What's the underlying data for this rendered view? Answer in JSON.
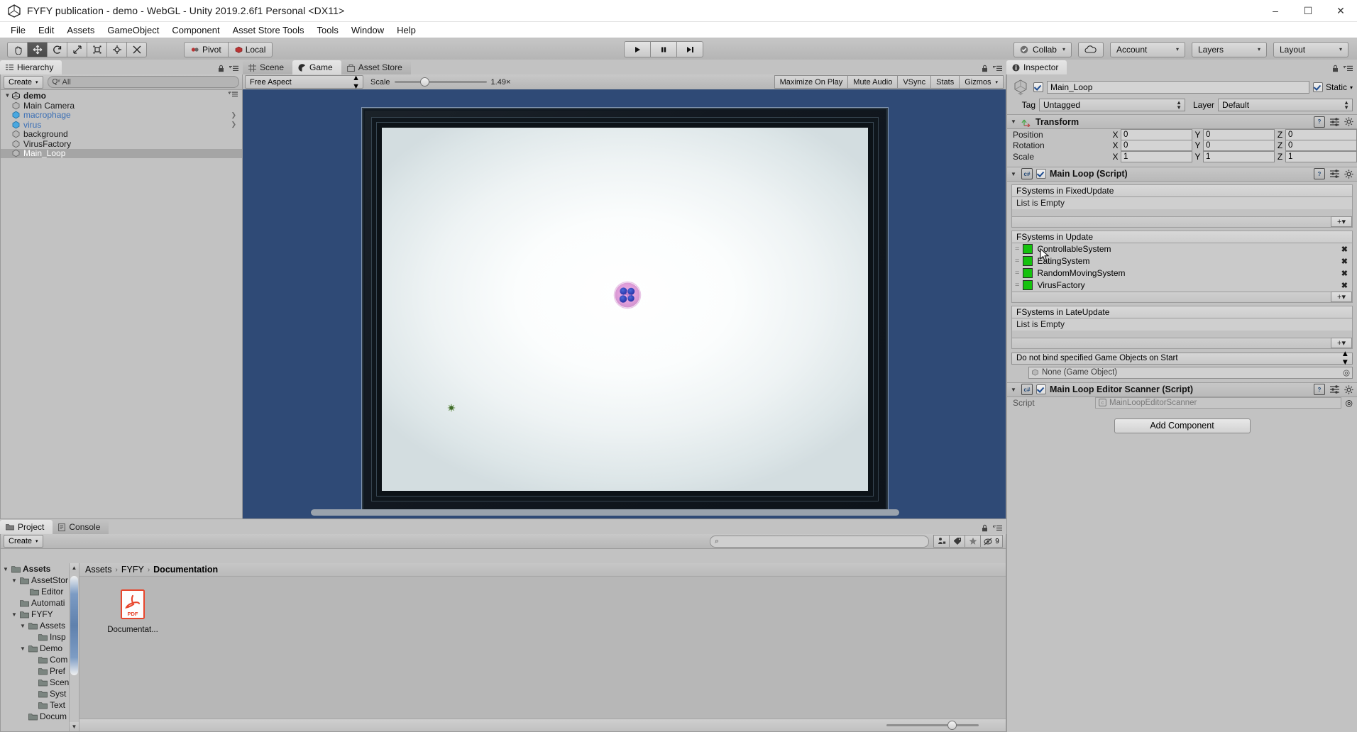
{
  "window": {
    "title": "FYFY publication - demo - WebGL - Unity 2019.2.6f1 Personal <DX11>",
    "minimize": "–",
    "maximize": "☐",
    "close": "✕"
  },
  "menubar": {
    "items": [
      "File",
      "Edit",
      "Assets",
      "GameObject",
      "Component",
      "Asset Store Tools",
      "Tools",
      "Window",
      "Help"
    ]
  },
  "toolbar": {
    "tools": [
      "hand-tool",
      "move-tool",
      "rotate-tool",
      "scale-tool",
      "rect-tool",
      "transform-tool",
      "custom-tool"
    ],
    "active_tool_index": 1,
    "pivot_label": "Pivot",
    "local_label": "Local",
    "play_label": "▶",
    "pause_label": "❙❙",
    "step_label": "▶|",
    "collab_label": "Collab",
    "cloud_label": "cloud-icon",
    "account_label": "Account",
    "layers_label": "Layers",
    "layout_label": "Layout",
    "caret": "▾"
  },
  "hierarchy": {
    "tab_label": "Hierarchy",
    "create_label": "Create",
    "create_caret": "▾",
    "search_placeholder": "All",
    "search_icon": "Qᵛ",
    "root": {
      "label": "demo",
      "expanded": true
    },
    "items": [
      {
        "label": "Main Camera",
        "type": "gameobject",
        "has_children": false
      },
      {
        "label": "macrophage",
        "type": "prefab",
        "has_children": true
      },
      {
        "label": "virus",
        "type": "prefab",
        "has_children": true
      },
      {
        "label": "background",
        "type": "gameobject",
        "has_children": false
      },
      {
        "label": "VirusFactory",
        "type": "gameobject",
        "has_children": false
      },
      {
        "label": "Main_Loop",
        "type": "gameobject",
        "has_children": false,
        "selected": true
      }
    ]
  },
  "gameview": {
    "tabs": [
      {
        "label": "Scene",
        "icon": "grid-icon",
        "selected": false
      },
      {
        "label": "Game",
        "icon": "gamepad-icon",
        "selected": true
      },
      {
        "label": "Asset Store",
        "icon": "store-icon",
        "selected": false
      }
    ],
    "aspect": "Free Aspect",
    "scale_label": "Scale",
    "scale_value": "1.49×",
    "buttons": [
      "Maximize On Play",
      "Mute Audio",
      "VSync",
      "Stats",
      "Gizmos"
    ],
    "gizmos_caret": "▾",
    "scene_objects": [
      {
        "name": "macrophage",
        "kind": "cell"
      },
      {
        "name": "virus",
        "kind": "virus"
      }
    ]
  },
  "inspector": {
    "tab_label": "Inspector",
    "object_name": "Main_Loop",
    "static_label": "Static",
    "static_caret": "▾",
    "tag_label": "Tag",
    "tag_value": "Untagged",
    "layer_label": "Layer",
    "layer_value": "Default",
    "transform": {
      "title": "Transform",
      "rows": [
        {
          "label": "Position",
          "x": "0",
          "y": "0",
          "z": "0"
        },
        {
          "label": "Rotation",
          "x": "0",
          "y": "0",
          "z": "0"
        },
        {
          "label": "Scale",
          "x": "1",
          "y": "1",
          "z": "1"
        }
      ],
      "axes": [
        "X",
        "Y",
        "Z"
      ]
    },
    "main_loop": {
      "title": "Main Loop (Script)",
      "fixed_update_header": "FSystems in FixedUpdate",
      "fixed_update_empty": "List is Empty",
      "update_header": "FSystems in Update",
      "update_systems": [
        {
          "label": "ControllableSystem",
          "color": "#15c20e"
        },
        {
          "label": "EatingSystem",
          "color": "#15c20e"
        },
        {
          "label": "RandomMovingSystem",
          "color": "#15c20e"
        },
        {
          "label": "VirusFactory",
          "color": "#15c20e"
        }
      ],
      "late_update_header": "FSystems in LateUpdate",
      "late_update_empty": "List is Empty",
      "bind_dropdown": "Do not bind specified Game Objects on Start",
      "object_field": "None (Game Object)",
      "plus_label": "+▾",
      "remove_label": "✖",
      "grip_label": "="
    },
    "editor_scanner": {
      "title": "Main Loop Editor Scanner (Script)",
      "script_label": "Script",
      "script_value": "MainLoopEditorScanner"
    },
    "add_component_label": "Add Component"
  },
  "project": {
    "tabs": [
      {
        "label": "Project",
        "icon": "folder-icon",
        "selected": true
      },
      {
        "label": "Console",
        "icon": "console-icon",
        "selected": false
      }
    ],
    "create_label": "Create",
    "create_caret": "▾",
    "search_placeholder": "",
    "search_icon": "⌕",
    "filter_icons": [
      "avatar-filter-icon",
      "label-filter-icon",
      "favorite-filter-icon",
      "hidden-filter-icon"
    ],
    "hidden_count": "9",
    "breadcrumb": [
      "Assets",
      "FYFY",
      "Documentation"
    ],
    "breadcrumb_sep": "›",
    "tree": [
      {
        "label": "Assets",
        "depth": 0,
        "tri": "▼",
        "bold": true
      },
      {
        "label": "AssetStor",
        "depth": 1,
        "tri": "▼",
        "bold": false
      },
      {
        "label": "Editor",
        "depth": 2,
        "tri": "",
        "bold": false
      },
      {
        "label": "Automati",
        "depth": 1,
        "tri": "",
        "bold": false
      },
      {
        "label": "FYFY",
        "depth": 1,
        "tri": "▼",
        "bold": false
      },
      {
        "label": "Assets",
        "depth": 2,
        "tri": "▼",
        "bold": false
      },
      {
        "label": "Insp",
        "depth": 3,
        "tri": "",
        "bold": false
      },
      {
        "label": "Demo",
        "depth": 2,
        "tri": "▼",
        "bold": false
      },
      {
        "label": "Com",
        "depth": 3,
        "tri": "",
        "bold": false
      },
      {
        "label": "Pref",
        "depth": 3,
        "tri": "",
        "bold": false
      },
      {
        "label": "Scen",
        "depth": 3,
        "tri": "",
        "bold": false
      },
      {
        "label": "Syst",
        "depth": 3,
        "tri": "",
        "bold": false
      },
      {
        "label": "Text",
        "depth": 3,
        "tri": "",
        "bold": false
      },
      {
        "label": "Docum",
        "depth": 2,
        "tri": "",
        "bold": false
      }
    ],
    "assets": [
      {
        "name": "Documentat...",
        "type": "pdf",
        "badge": "PDF"
      }
    ]
  },
  "colors": {
    "background": "#c2c2c2",
    "game_background": "#2f4a76",
    "selection": "#a5a5a5",
    "prefab_blue": "#3b6fb5",
    "system_green": "#15c20e",
    "pdf_red": "#e8462c"
  }
}
